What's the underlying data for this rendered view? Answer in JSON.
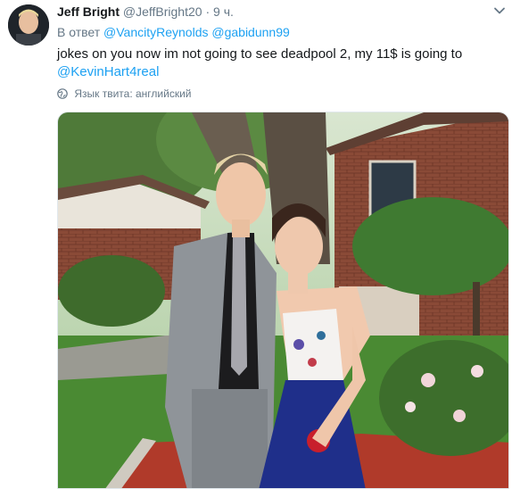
{
  "tweet": {
    "author_name": "Jeff Bright",
    "author_handle": "@JeffBright20",
    "separator": "·",
    "time": "9 ч.",
    "reply_prefix": "В ответ",
    "mention_1": "@VancityReynolds",
    "mention_2": "@gabidunn99",
    "text": "jokes on you now im not going to see deadpool 2, my 11$ is going to",
    "text_mention": "@KevinHart4real",
    "language_label": "Язык твита: английский",
    "icons": [
      "chevron-down-icon",
      "globe-icon"
    ],
    "colors": {
      "link": "#1da1f2",
      "muted": "#657786",
      "text": "#14171a"
    }
  }
}
